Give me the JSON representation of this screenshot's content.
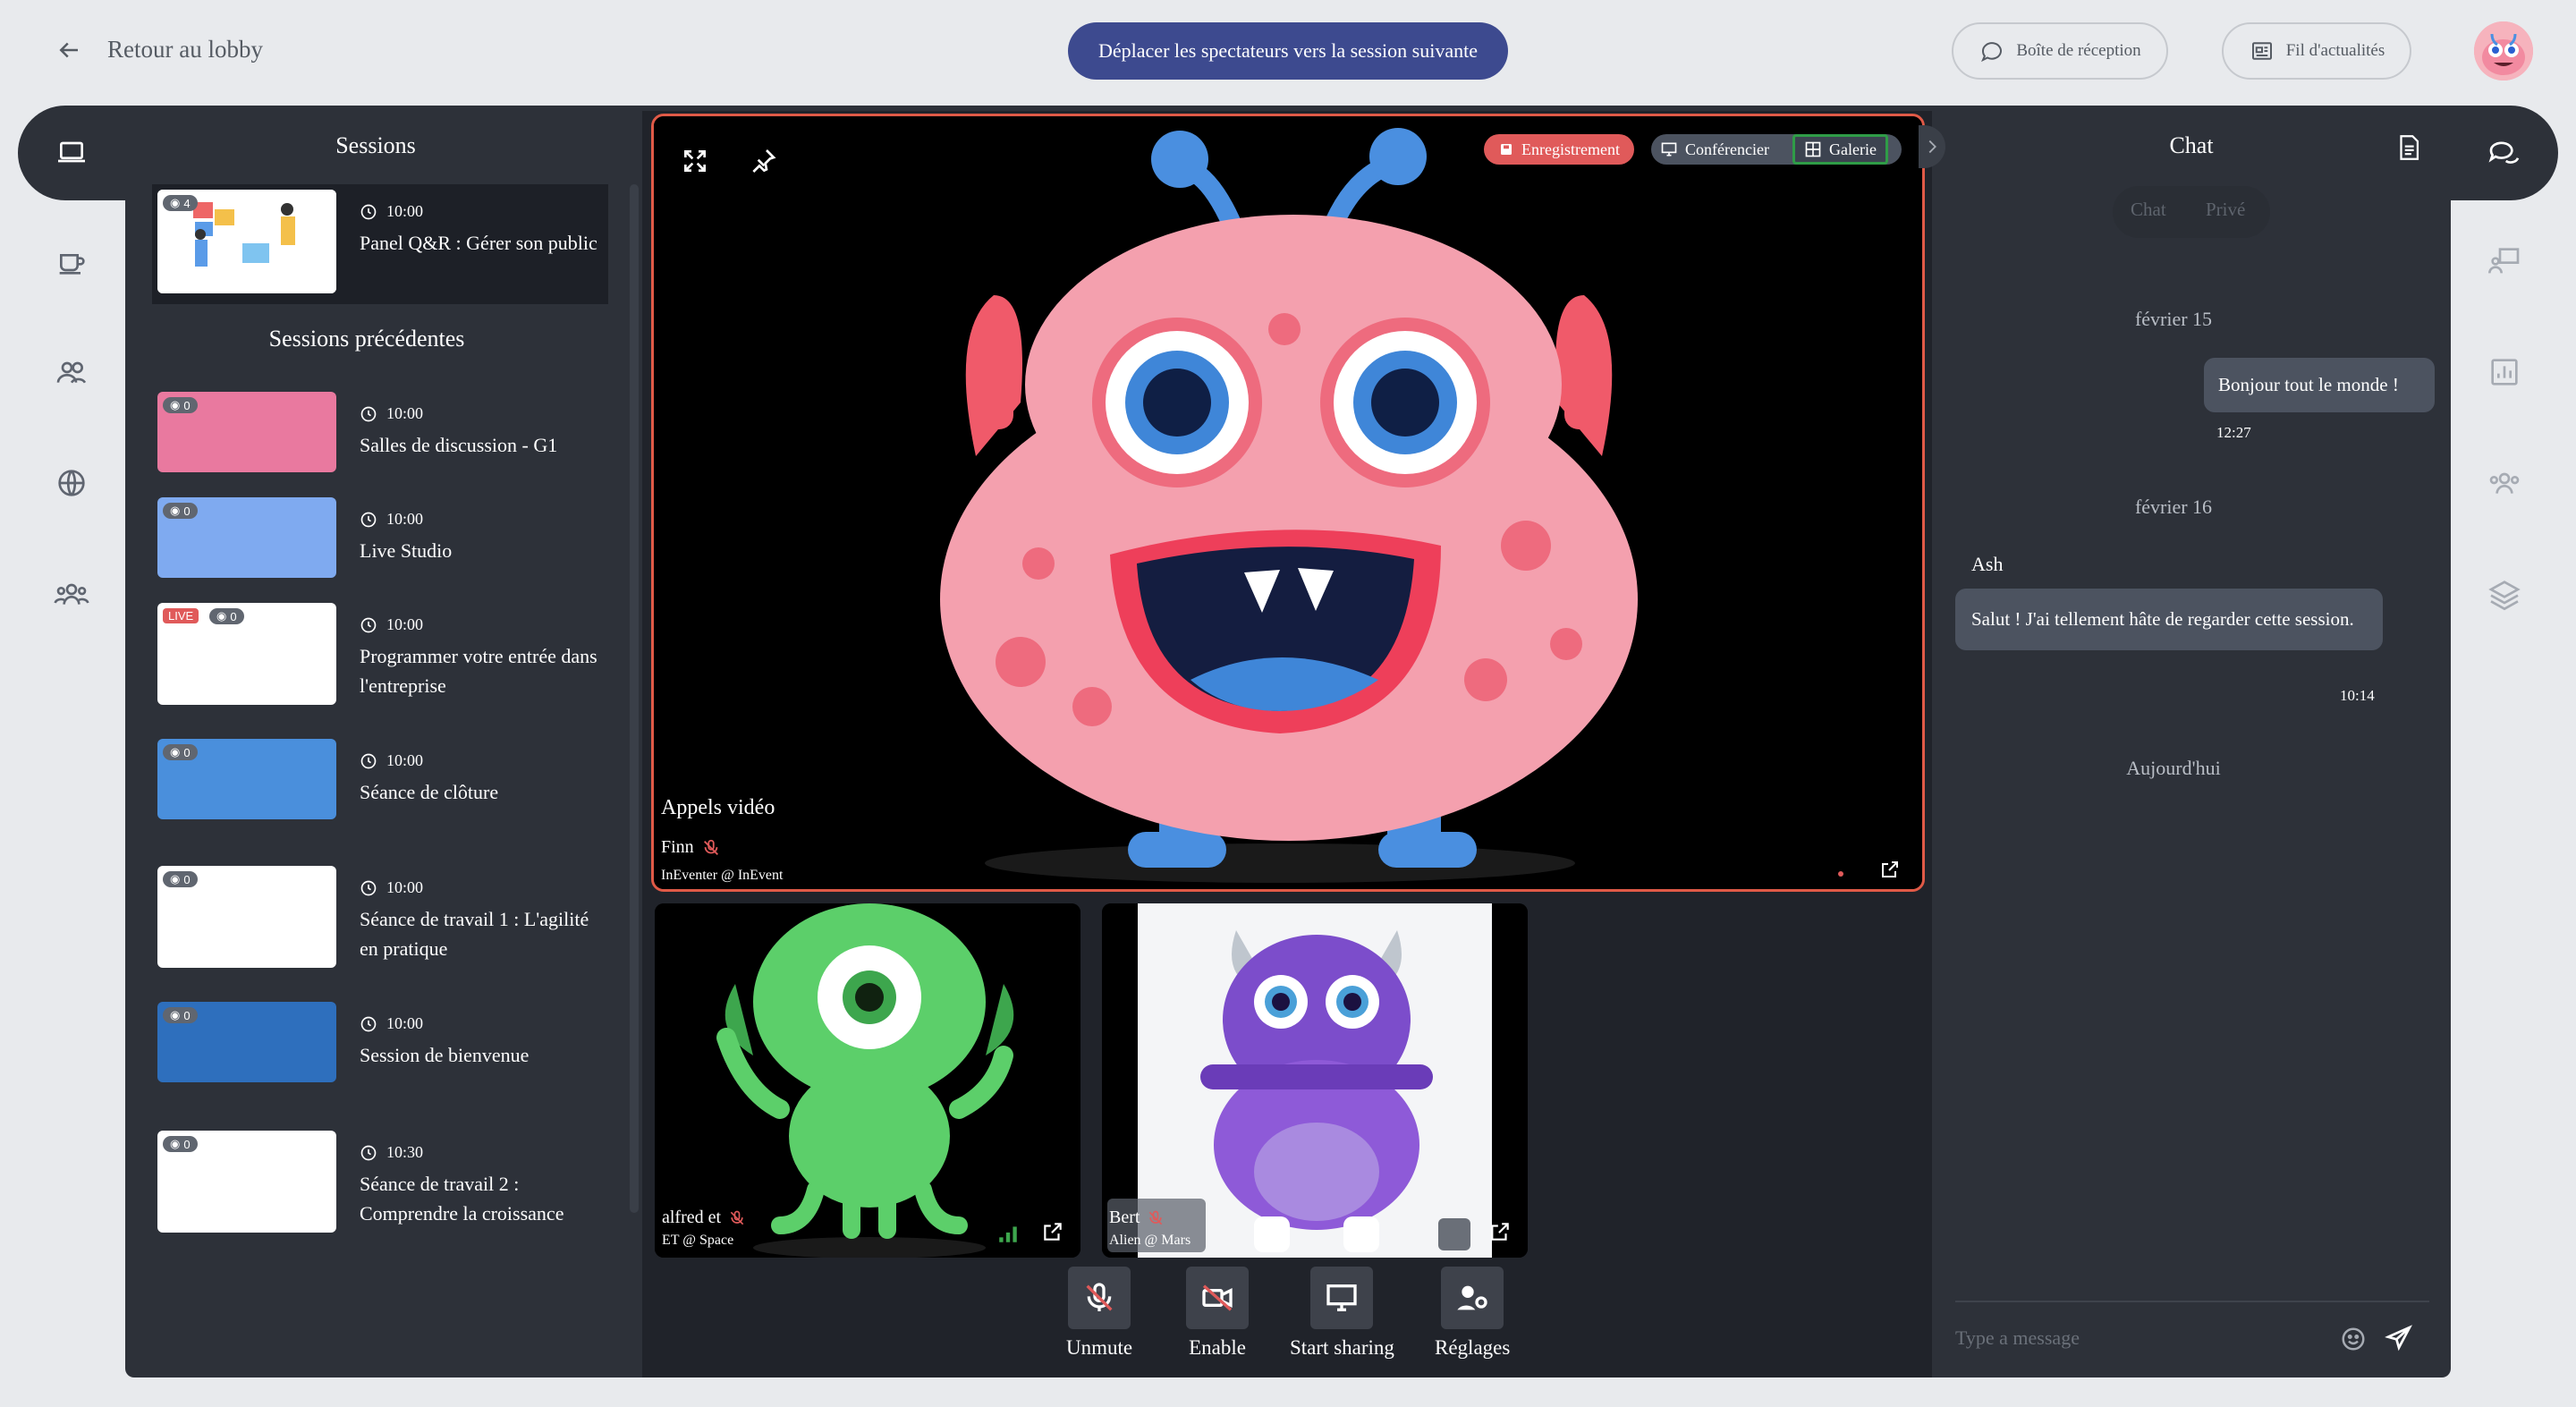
{
  "topbar": {
    "back_label": "Retour au lobby",
    "move_button": "Déplacer les spectateurs vers la session suivante",
    "inbox": "Boîte de réception",
    "news": "Fil d'actualités"
  },
  "left": {
    "sessions_title": "Sessions",
    "previous_title": "Sessions précédentes",
    "current": {
      "time": "10:00",
      "name": "Panel Q&R : Gérer son public",
      "views": "4"
    },
    "previous": [
      {
        "time": "10:00",
        "name": "Salles de discussion - G1",
        "views": "0",
        "color": "#e9799f"
      },
      {
        "time": "10:00",
        "name": "Live Studio",
        "views": "0",
        "color": "#7faaf0"
      },
      {
        "time": "10:00",
        "name": "Programmer votre entrée dans l'entreprise",
        "views": "0",
        "live": "LIVE",
        "color": "#ffffff"
      },
      {
        "time": "10:00",
        "name": "Séance de clôture",
        "views": "0",
        "color": "#4a8fdc"
      },
      {
        "time": "10:00",
        "name": "Séance de travail 1 : L'agilité en pratique",
        "views": "0",
        "color": "#ffffff"
      },
      {
        "time": "10:00",
        "name": "Session de bienvenue",
        "views": "0",
        "color": "#2e6fbd"
      },
      {
        "time": "10:30",
        "name": "Séance de travail 2 : Comprendre la croissance",
        "views": "0",
        "color": "#ffffff"
      }
    ]
  },
  "video": {
    "recording": "Enregistrement",
    "speaker": "Conférencier",
    "gallery": "Galerie",
    "section_label": "Appels vidéo",
    "main_name": "Finn",
    "main_sub": "InEventer @ InEvent",
    "tiles": [
      {
        "name": "alfred et",
        "sub": "ET @ Space"
      },
      {
        "name": "Bert",
        "sub": "Alien @ Mars"
      }
    ],
    "controls": {
      "unmute": "Unmute",
      "enable": "Enable",
      "share": "Start sharing",
      "settings": "Réglages"
    }
  },
  "chat": {
    "title": "Chat",
    "tab_chat": "Chat",
    "tab_private": "Privé",
    "date1": "février 15",
    "msg1": "Bonjour tout le monde !",
    "time1": "12:27",
    "date2": "février 16",
    "author2": "Ash",
    "msg2": "Salut ! J'ai tellement hâte de regarder cette session.",
    "time2": "10:14",
    "date3": "Aujourd'hui",
    "placeholder": "Type a message"
  }
}
